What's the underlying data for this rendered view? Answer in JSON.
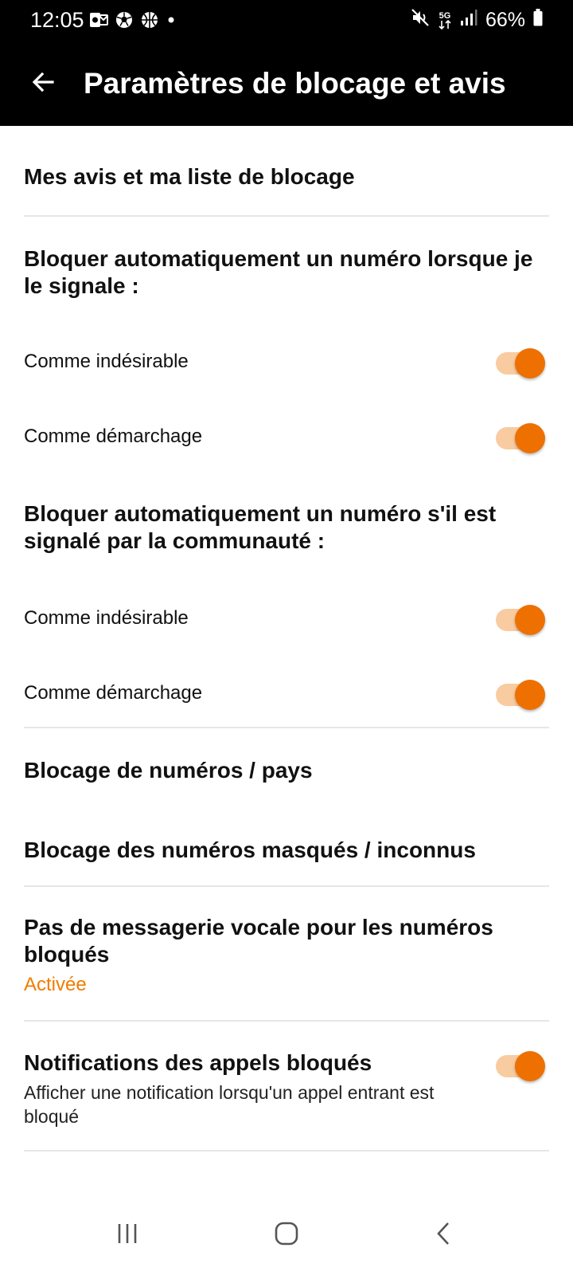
{
  "status_bar": {
    "time": "12:05",
    "left_icons": [
      "outlook-icon",
      "soccer-ball-icon",
      "basketball-icon",
      "dot-icon"
    ],
    "right_icons": [
      "mute-icon",
      "5g-icon",
      "signal-icon",
      "battery-icon"
    ],
    "network_label": "5G",
    "battery": "66%"
  },
  "app_bar": {
    "title": "Paramètres de blocage et avis",
    "back_icon": "arrow-left-icon"
  },
  "sections": {
    "reviews_link": "Mes avis et ma liste de blocage",
    "auto_block_self": {
      "heading": "Bloquer automatiquement un numéro lorsque je le signale :",
      "options": [
        {
          "label": "Comme indésirable",
          "enabled": true
        },
        {
          "label": "Comme démarchage",
          "enabled": true
        }
      ]
    },
    "auto_block_community": {
      "heading": "Bloquer automatiquement un numéro s'il est signalé par la communauté :",
      "options": [
        {
          "label": "Comme indésirable",
          "enabled": true
        },
        {
          "label": "Comme démarchage",
          "enabled": true
        }
      ]
    },
    "number_country_block": "Blocage de numéros / pays",
    "hidden_unknown_block": "Blocage des numéros masqués / inconnus",
    "no_voicemail": {
      "title": "Pas de messagerie vocale pour les numéros bloqués",
      "status": "Activée"
    },
    "blocked_notifications": {
      "title": "Notifications des appels bloqués",
      "description": "Afficher une notification lorsqu'un appel entrant est bloqué",
      "enabled": true
    }
  },
  "nav_bar": {
    "buttons": [
      "recent-apps-icon",
      "home-icon",
      "back-icon"
    ]
  },
  "colors": {
    "accent": "#ee7000",
    "toggle_track": "#f9cba0",
    "header_bg": "#000000"
  }
}
